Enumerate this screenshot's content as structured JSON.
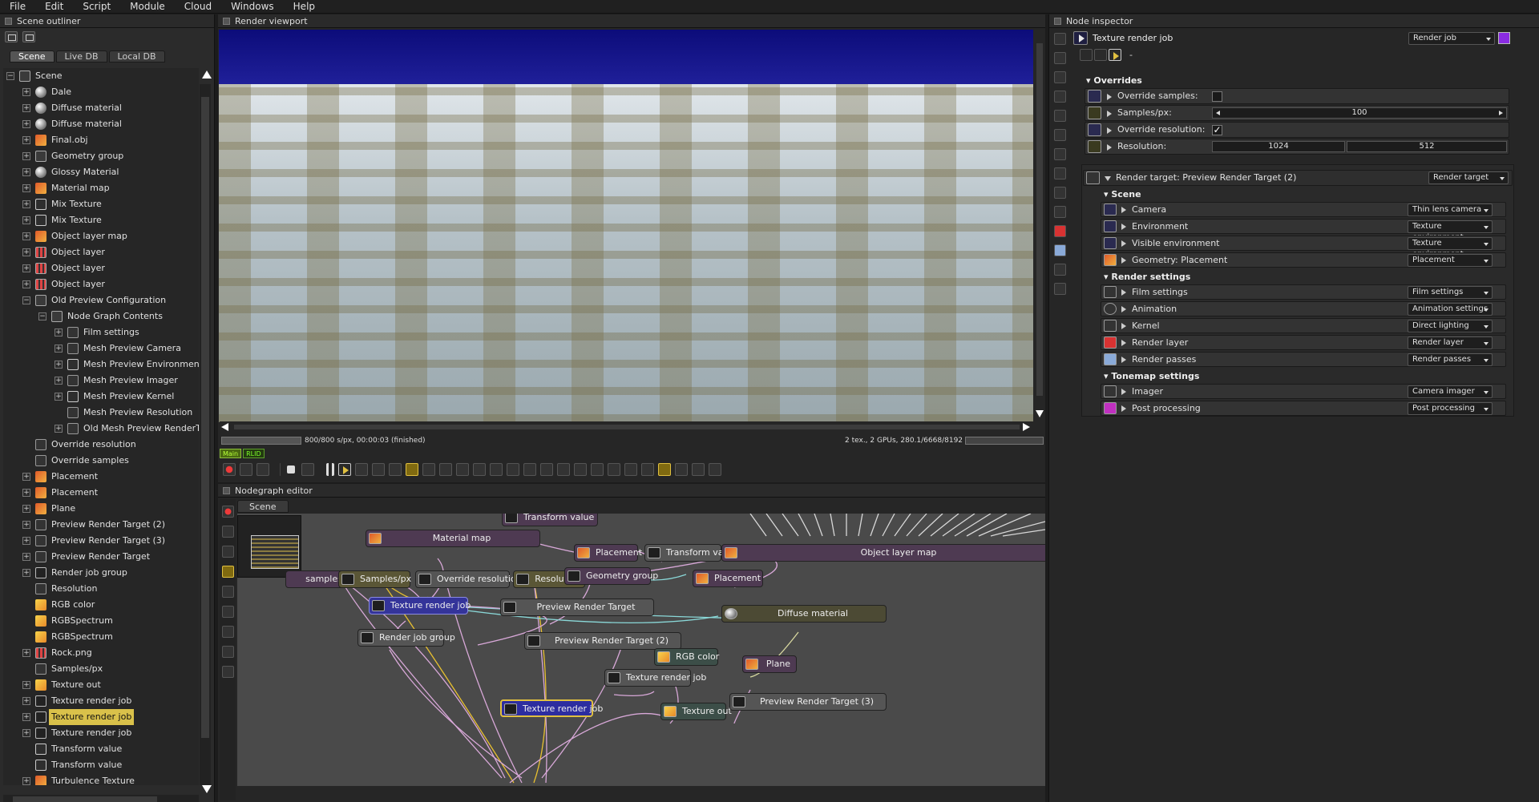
{
  "menu": [
    "File",
    "Edit",
    "Script",
    "Module",
    "Cloud",
    "Windows",
    "Help"
  ],
  "outliner": {
    "title": "Scene outliner",
    "tabs": [
      "Scene",
      "Live DB",
      "Local DB"
    ],
    "items": [
      {
        "label": "Scene",
        "depth": 0,
        "exp": "−",
        "icon": "geo"
      },
      {
        "label": "Dale",
        "depth": 1,
        "exp": "+",
        "icon": "sphere"
      },
      {
        "label": "Diffuse material",
        "depth": 1,
        "exp": "+",
        "icon": "sphere"
      },
      {
        "label": "Diffuse material",
        "depth": 1,
        "exp": "+",
        "icon": "sphere"
      },
      {
        "label": "Final.obj",
        "depth": 1,
        "exp": "+",
        "icon": "tex"
      },
      {
        "label": "Geometry group",
        "depth": 1,
        "exp": "+",
        "icon": "geo"
      },
      {
        "label": "Glossy Material",
        "depth": 1,
        "exp": "+",
        "icon": "sphere"
      },
      {
        "label": "Material map",
        "depth": 1,
        "exp": "+",
        "icon": "tex"
      },
      {
        "label": "Mix Texture",
        "depth": 1,
        "exp": "+",
        "icon": "mix"
      },
      {
        "label": "Mix Texture",
        "depth": 1,
        "exp": "+",
        "icon": "mix"
      },
      {
        "label": "Object layer map",
        "depth": 1,
        "exp": "+",
        "icon": "tex"
      },
      {
        "label": "Object layer",
        "depth": 1,
        "exp": "+",
        "icon": "grid"
      },
      {
        "label": "Object layer",
        "depth": 1,
        "exp": "+",
        "icon": "grid"
      },
      {
        "label": "Object layer",
        "depth": 1,
        "exp": "+",
        "icon": "grid"
      },
      {
        "label": "Old Preview Configuration",
        "depth": 1,
        "exp": "−",
        "icon": "geo"
      },
      {
        "label": "Node Graph Contents",
        "depth": 2,
        "exp": "−",
        "icon": "geo"
      },
      {
        "label": "Film settings",
        "depth": 3,
        "exp": "+",
        "icon": "film"
      },
      {
        "label": "Mesh Preview Camera",
        "depth": 3,
        "exp": "+",
        "icon": "film"
      },
      {
        "label": "Mesh Preview Environment",
        "depth": 3,
        "exp": "+",
        "icon": "mix"
      },
      {
        "label": "Mesh Preview Imager",
        "depth": 3,
        "exp": "+",
        "icon": "film"
      },
      {
        "label": "Mesh Preview Kernel",
        "depth": 3,
        "exp": "+",
        "icon": "mix"
      },
      {
        "label": "Mesh Preview Resolution",
        "depth": 3,
        "exp": "",
        "icon": "film"
      },
      {
        "label": "Old Mesh Preview RenderT",
        "depth": 3,
        "exp": "+",
        "icon": "film"
      },
      {
        "label": "Override resolution",
        "depth": 1,
        "exp": "",
        "icon": "film"
      },
      {
        "label": "Override samples",
        "depth": 1,
        "exp": "",
        "icon": "film"
      },
      {
        "label": "Placement",
        "depth": 1,
        "exp": "+",
        "icon": "tex"
      },
      {
        "label": "Placement",
        "depth": 1,
        "exp": "+",
        "icon": "tex"
      },
      {
        "label": "Plane",
        "depth": 1,
        "exp": "+",
        "icon": "tex"
      },
      {
        "label": "Preview Render Target (2)",
        "depth": 1,
        "exp": "+",
        "icon": "film"
      },
      {
        "label": "Preview Render Target (3)",
        "depth": 1,
        "exp": "+",
        "icon": "film"
      },
      {
        "label": "Preview Render Target",
        "depth": 1,
        "exp": "+",
        "icon": "film"
      },
      {
        "label": "Render job group",
        "depth": 1,
        "exp": "+",
        "icon": "play"
      },
      {
        "label": "Resolution",
        "depth": 1,
        "exp": "",
        "icon": "film"
      },
      {
        "label": "RGB color",
        "depth": 1,
        "exp": "",
        "icon": "rgbsp"
      },
      {
        "label": "RGBSpectrum",
        "depth": 1,
        "exp": "",
        "icon": "rgbsp"
      },
      {
        "label": "RGBSpectrum",
        "depth": 1,
        "exp": "",
        "icon": "rgbsp"
      },
      {
        "label": "Rock.png",
        "depth": 1,
        "exp": "+",
        "icon": "grid"
      },
      {
        "label": "Samples/px",
        "depth": 1,
        "exp": "",
        "icon": "film"
      },
      {
        "label": "Texture out",
        "depth": 1,
        "exp": "+",
        "icon": "rgbsp"
      },
      {
        "label": "Texture render job",
        "depth": 1,
        "exp": "+",
        "icon": "play"
      },
      {
        "label": "Texture render job",
        "depth": 1,
        "exp": "+",
        "icon": "play",
        "selected": true
      },
      {
        "label": "Texture render job",
        "depth": 1,
        "exp": "+",
        "icon": "play"
      },
      {
        "label": "Transform value",
        "depth": 1,
        "exp": "",
        "icon": "tv"
      },
      {
        "label": "Transform value",
        "depth": 1,
        "exp": "",
        "icon": "tv"
      },
      {
        "label": "Turbulence Texture",
        "depth": 1,
        "exp": "+",
        "icon": "tex"
      }
    ]
  },
  "viewport": {
    "title": "Render viewport",
    "status_left": "800/800 s/px, 00:00:03 (finished)",
    "status_right": "2 tex., 2 GPUs, 280.1/6668/8192 MB",
    "badge_main": "Main",
    "badge_rlid": "RLID"
  },
  "nodegraph": {
    "title": "Nodegraph editor",
    "tab": "Scene",
    "nodes": {
      "samples": "samples",
      "samples_px": "Samples/px",
      "override_resolution": "Override resolution",
      "resolution": "Resolution",
      "material_map": "Material map",
      "transform_value_top": "Transform value",
      "placement1": "Placement",
      "transform_value2": "Transform value",
      "object_layer_map": "Object layer map",
      "geometry_group": "Geometry group",
      "placement2": "Placement",
      "texture_render_job1": "Texture render job",
      "preview_render_target": "Preview Render Target",
      "diffuse_material": "Diffuse material",
      "render_job_group": "Render job group",
      "preview_render_target2": "Preview Render Target (2)",
      "rgb_color": "RGB color",
      "plane": "Plane",
      "texture_render_job2": "Texture render job",
      "texture_render_job3": "Texture render job",
      "texture_out": "Texture out",
      "preview_render_target3": "Preview Render Target (3)"
    }
  },
  "inspector": {
    "title": "Node inspector",
    "node_name": "Texture render job",
    "node_type": "Render job",
    "swatch_color": "#8a2be2",
    "mini_label": "-",
    "overrides_header": "Overrides",
    "override_samples_label": "Override samples:",
    "samples_label": "Samples/px:",
    "samples_value": "100",
    "override_resolution_label": "Override resolution:",
    "override_resolution_check": "✓",
    "resolution_label": "Resolution:",
    "resolution_x": "1024",
    "resolution_y": "512",
    "render_target_label": "Render target: Preview Render Target (2)",
    "render_target_type": "Render target",
    "scene_header": "Scene",
    "camera_label": "Camera",
    "camera_type": "Thin lens camera",
    "environment_label": "Environment",
    "environment_type": "Texture environment",
    "visible_env_label": "Visible environment",
    "visible_env_type": "Texture environment",
    "geometry_label": "Geometry: Placement",
    "geometry_type": "Placement",
    "render_settings_header": "Render settings",
    "film_label": "Film settings",
    "film_type": "Film settings",
    "animation_label": "Animation",
    "animation_type": "Animation settings",
    "kernel_label": "Kernel",
    "kernel_type": "Direct lighting",
    "render_layer_label": "Render layer",
    "render_layer_type": "Render layer",
    "render_passes_label": "Render passes",
    "render_passes_type": "Render passes",
    "tonemap_header": "Tonemap settings",
    "imager_label": "Imager",
    "imager_type": "Camera imager",
    "post_label": "Post processing",
    "post_type": "Post processing"
  }
}
